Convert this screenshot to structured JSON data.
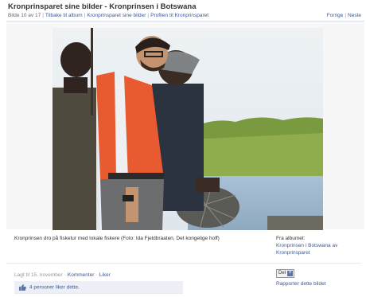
{
  "page": {
    "title": "Kronprinsparet sine bilder - Kronprinsen i Botswana"
  },
  "subnav": {
    "counter": "Bilde 10 av 17",
    "back_link": "Tilbake til album",
    "album_link": "Kronprinsparet sine bilder",
    "profile_link": "Profilen til Kronprinsparet",
    "prev": "Forrige",
    "next": "Neste"
  },
  "photo": {
    "caption": "Kronprinsen dro på fisketur med lokale fiskere (Foto: Ida Fjeldbraaten, Det kongelige hoff)"
  },
  "album": {
    "from_label": "Fra albumet:",
    "name": "Kronprinsen i Botswana av",
    "owner": "Kronprinsparet"
  },
  "meta": {
    "date": "Lagt til 15. november",
    "comment_link": "Kommenter",
    "like_link": "Liker"
  },
  "likes": {
    "text": "4 personer liker dette."
  },
  "actions": {
    "share_label": "Del",
    "share_plus": "+",
    "report_link": "Rapporter dette bildet"
  },
  "colors": {
    "link": "#3b5998",
    "likes_bg": "#eceff5",
    "vest": "#e85a30"
  },
  "icons": {
    "thumb": "thumbs-up-icon",
    "plus": "plus-icon"
  }
}
